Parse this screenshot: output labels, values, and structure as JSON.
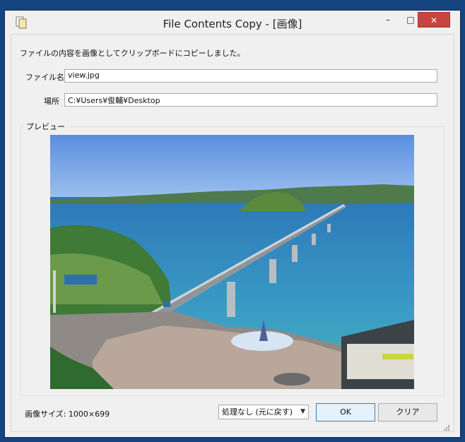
{
  "window": {
    "title": "File Contents Copy - [画像]"
  },
  "titlebar_buttons": {
    "minimize": "–",
    "maximize": "□",
    "close": "✕"
  },
  "message": "ファイルの内容を画像としてクリップボードにコピーしました。",
  "fields": {
    "filename_label": "ファイル名",
    "filename_value": "view.jpg",
    "location_label": "場所",
    "location_value": "C:¥Users¥俊輔¥Desktop"
  },
  "preview": {
    "group_label": "プレビュー"
  },
  "footer": {
    "image_size": "画像サイズ: 1000×699",
    "process_option": "処理なし (元に戻す)",
    "ok_label": "OK",
    "clear_label": "クリア"
  },
  "icons": {
    "app": "copy-document-icon",
    "combo_arrow": "chevron-down-icon",
    "resize": "resize-grip-icon"
  }
}
